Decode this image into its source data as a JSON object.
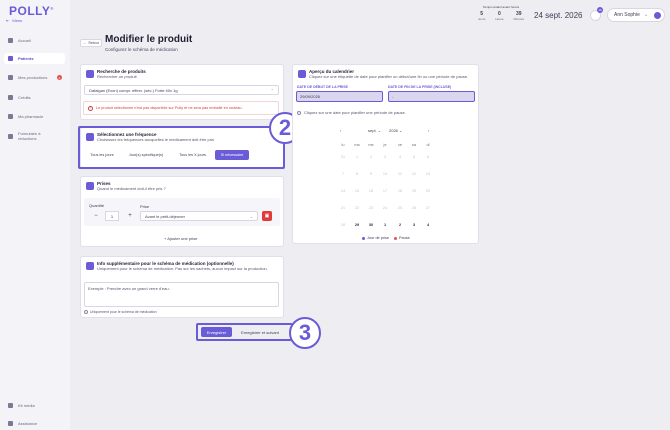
{
  "brand": {
    "logo": "POLLY",
    "menu_label": "Menu"
  },
  "sidebar": {
    "items": [
      {
        "label": "Accueil",
        "icon": "home-icon"
      },
      {
        "label": "Patients",
        "icon": "user-icon",
        "active": true
      },
      {
        "label": "Mes productions",
        "icon": "print-icon",
        "badge": "4"
      },
      {
        "label": "Crédits",
        "icon": "stack-icon"
      },
      {
        "label": "Ma pharmacie",
        "icon": "plus-icon"
      },
      {
        "label": "Formulaire à réductions",
        "icon": "list-icon"
      }
    ],
    "footer": [
      {
        "label": "Kit média",
        "icon": "media-icon"
      },
      {
        "label": "Assistance",
        "icon": "headset-icon"
      }
    ]
  },
  "topbar": {
    "timer_label": "Temps restant avant l'envoi",
    "timer": [
      {
        "value": "5",
        "unit": "Jours"
      },
      {
        "value": "0",
        "unit": "Heure"
      },
      {
        "value": "39",
        "unit": "Minutes"
      }
    ],
    "date": "24 sept. 2026",
    "notification_count": "16",
    "user_name": "Ann Sophie"
  },
  "page": {
    "back_label": "Retour",
    "title": "Modifier le produit",
    "subtitle": "Configurez le schéma de médication"
  },
  "product_search": {
    "title": "Recherche de produits",
    "subtitle": "Rechercher un produit",
    "selected": "Dafalgan (Exon) compr. efferv. (séc.) Forte 40x 1g",
    "warning": "Le produit sélectionné n'est pas disponible sur Polly et ne sera pas emballé en rouleau."
  },
  "frequency": {
    "title": "Sélectionnez une fréquence",
    "subtitle": "Choisissez les fréquences auxquelles le médicament doit être pris",
    "options": [
      "Tous les jours",
      "Jour(s) spécifique(s)",
      "Tous les X jours",
      "Si nécessaire"
    ],
    "selected_index": 3
  },
  "intakes": {
    "title": "Prises",
    "subtitle": "Quand le médicament doit-il être pris ?",
    "quantity_label": "Quantité",
    "quantity_value": "1",
    "intake_label": "Prise",
    "intake_value": "Avant le petit-déjeuner",
    "add_label": "+ Ajouter une prise"
  },
  "extra_info": {
    "title": "Info supplémentaire pour le schéma de médication (optionnelle)",
    "subtitle": "Uniquement pour le schéma de médication. Pas sur les sachets, aucun impact sur la production.",
    "placeholder": "Exemple : Prendre avec un grand verre d'eau.",
    "note": "Uniquement pour le schéma de médication"
  },
  "actions": {
    "save": "Enregistrer",
    "save_next": "Enregistrer et suivant"
  },
  "calendar": {
    "title": "Aperçu du calendrier",
    "subtitle": "Cliquez sur une étiquette de date pour planifier un début/une fin ou une période de pause.",
    "start_label": "DATE DE DÉBUT DE LA PRISE",
    "start_value": "29/09/2026",
    "end_label": "DATE DE FIN DE LA PRISE (INCLUSE)",
    "end_value": "-",
    "hint": "Cliquez sur une date pour planifier une période de pause.",
    "month": "sept.",
    "year": "2026",
    "weekdays": [
      "lu",
      "ma",
      "me",
      "je",
      "ve",
      "sa",
      "di"
    ],
    "weeks": [
      [
        "31",
        "1",
        "2",
        "3",
        "4",
        "5",
        "6"
      ],
      [
        "7",
        "8",
        "9",
        "10",
        "11",
        "12",
        "13"
      ],
      [
        "14",
        "15",
        "16",
        "17",
        "18",
        "19",
        "20"
      ],
      [
        "21",
        "22",
        "23",
        "24",
        "25",
        "26",
        "27"
      ],
      [
        "28",
        "29",
        "30",
        "1",
        "2",
        "3",
        "4"
      ]
    ],
    "legend": [
      {
        "label": "Jour de prise",
        "color": "#6a5bd6"
      },
      {
        "label": "Pause",
        "color": "#e25252"
      }
    ]
  },
  "callouts": [
    "2",
    "3"
  ],
  "colors": {
    "accent": "#6a5bd6",
    "danger": "#e03a3a"
  }
}
